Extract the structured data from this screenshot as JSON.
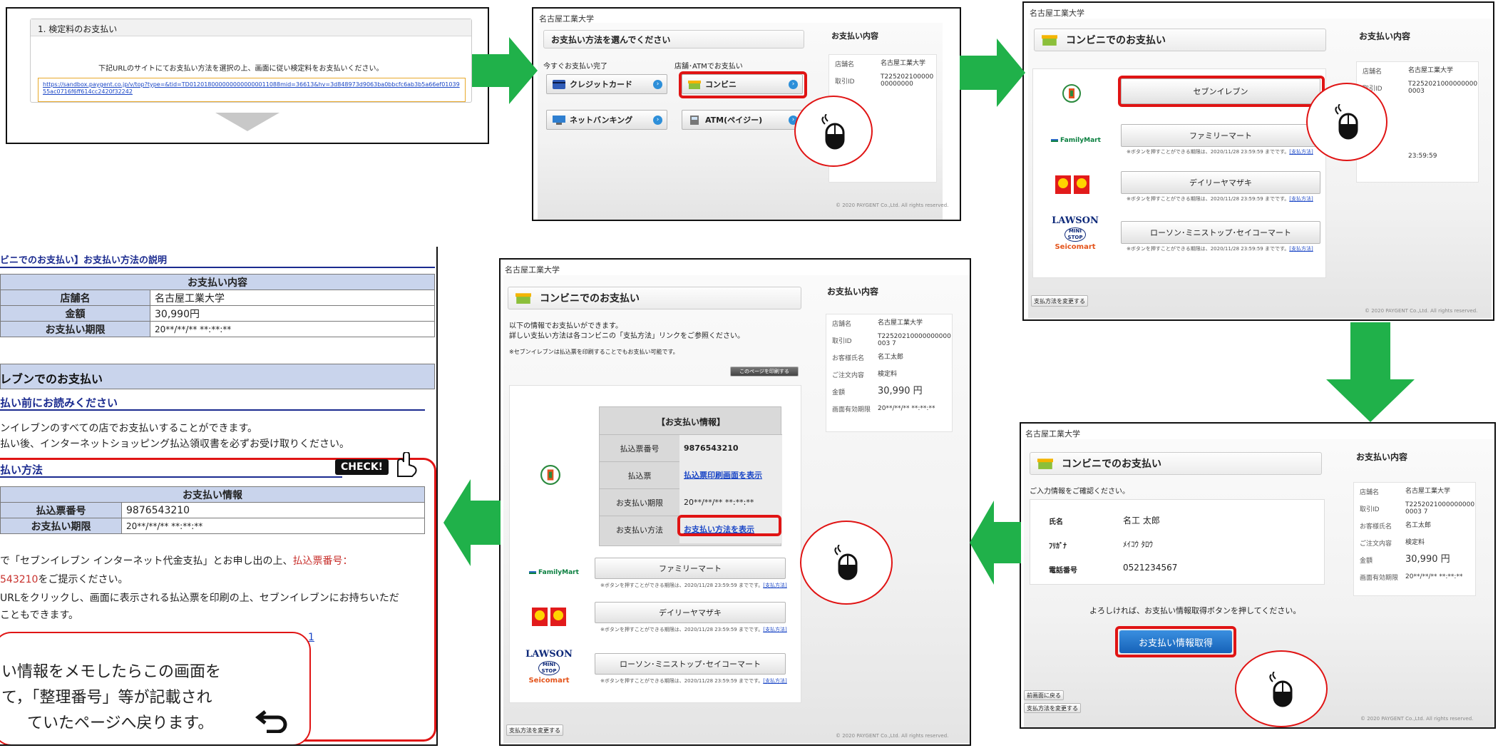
{
  "panel1": {
    "title": "1. 検定料のお支払い",
    "instruction": "下記URLのサイトにてお支払い方法を選択の上、画面に従い検定料をお支払いください。",
    "url": "https://sandbox.paygent.co.jp/v/top?type=&tid=TD0120180000000000000011088mid=36613&hv=3d848973d9063ba0bbcfc6ab3b5a66ef0103955ac0716f6ff614cc2420f32242"
  },
  "panel2": {
    "university": "名古屋工業大学",
    "heading": "お支払い方法を選んでください",
    "col1": "今すぐお支払い完了",
    "col2": "店舗･ATMでお支払い",
    "credit": "クレジットカード",
    "netbank": "ネットバンキング",
    "conveni": "コンビニ",
    "atm": "ATM(ペイジー)",
    "side_title": "お支払い内容",
    "side_rows": [
      {
        "k": "店舗名",
        "v": "名古屋工業大学"
      },
      {
        "k": "取引ID",
        "v": "T22520210000000000000"
      }
    ],
    "copyright": "© 2020 PAYGENT Co.,Ltd. All rights reserved."
  },
  "panel3": {
    "university": "名古屋工業大学",
    "heading": "コンビニでのお支払い",
    "stores": [
      "セブンイレブン",
      "ファミリーマート",
      "デイリーヤマザキ",
      "ローソン･ミニストップ･セイコーマート"
    ],
    "note_text": "※ボタンを押すことができる期限は、2020/11/28 23:59:59 までです。",
    "note_link": "[支払方法]",
    "change_method": "支払方法を変更する",
    "side_title": "お支払い内容",
    "side_rows": [
      {
        "k": "店舗名",
        "v": "名古屋工業大学"
      },
      {
        "k": "取引ID",
        "v": "T22520210000000000003"
      },
      {
        "k": "",
        "v": ""
      },
      {
        "k": "",
        "v": ""
      },
      {
        "k": "",
        "v": ""
      },
      {
        "k": "",
        "v": "23:59:59"
      }
    ],
    "copyright": "© 2020 PAYGENT Co.,Ltd. All rights reserved.",
    "logo_familymart": "FamilyMart",
    "logo_lawson": "LAWSON",
    "logo_ministop": "MINI STOP",
    "logo_seicomart": "Seicomart"
  },
  "panel4": {
    "university": "名古屋工業大学",
    "heading": "コンビニでのお支払い",
    "confirm": "ご入力情報をご確認ください。",
    "rows": [
      {
        "k": "氏名",
        "v": "名工 太郎"
      },
      {
        "k": "ﾌﾘｶﾞﾅ",
        "v": "ﾒｲｺｳ ﾀﾛｳ"
      },
      {
        "k": "電話番号",
        "v": "0521234567"
      }
    ],
    "prompt": "よろしければ、お支払い情報取得ボタンを押してください。",
    "button": "お支払い情報取得",
    "back": "前画面に戻る",
    "change_method": "支払方法を変更する",
    "side_title": "お支払い内容",
    "side_rows": [
      {
        "k": "店舗名",
        "v": "名古屋工業大学"
      },
      {
        "k": "取引ID",
        "v": "T22520210000000000003 7"
      },
      {
        "k": "お客様氏名",
        "v": "名工太郎"
      },
      {
        "k": "ご注文内容",
        "v": "検定料"
      },
      {
        "k": "金額",
        "v": "30,990 円"
      },
      {
        "k": "画面有効期限",
        "v": "20**/**/** **:**:**"
      }
    ],
    "copyright": "© 2020 PAYGENT Co.,Ltd. All rights reserved."
  },
  "panel5": {
    "university": "名古屋工業大学",
    "heading": "コンビニでのお支払い",
    "line1": "以下の情報でお支払いができます。",
    "line2": "詳しい支払い方法は各コンビニの「支払方法」リンクをご参照ください。",
    "line3": "※セブンイレブンは払込票を印刷することでもお支払い可能です。",
    "print_btn": "このページを印刷する",
    "info_title": "【お支払い情報】",
    "info_rows": [
      {
        "k": "払込票番号",
        "v": "9876543210"
      },
      {
        "k": "払込票",
        "v": "払込票印刷画面を表示"
      },
      {
        "k": "お支払い期限",
        "v": "20**/**/** **:**:**"
      },
      {
        "k": "お支払い方法",
        "v": "お支払い方法を表示"
      }
    ],
    "stores": [
      "ファミリーマート",
      "デイリーヤマザキ",
      "ローソン･ミニストップ･セイコーマート"
    ],
    "note_text": "※ボタンを押すことができる期限は、2020/11/28 23:59:59 までです。",
    "note_link": "[支払方法]",
    "change_method": "支払方法を変更する",
    "side_title": "お支払い内容",
    "side_rows": [
      {
        "k": "店舗名",
        "v": "名古屋工業大学"
      },
      {
        "k": "取引ID",
        "v": "T22520210000000000003 7"
      },
      {
        "k": "お客様氏名",
        "v": "名工太郎"
      },
      {
        "k": "ご注文内容",
        "v": "検定料"
      },
      {
        "k": "金額",
        "v": "30,990 円"
      },
      {
        "k": "画面有効期限",
        "v": "20**/**/** **:**:**"
      }
    ],
    "copyright": "© 2020 PAYGENT Co.,Ltd. All rights reserved.",
    "logo_familymart": "FamilyMart",
    "logo_lawson": "LAWSON",
    "logo_ministop": "MINI STOP",
    "logo_seicomart": "Seicomart"
  },
  "panel6": {
    "title": "ビニでのお支払い】お支払い方法の説明",
    "table_head": "お支払い内容",
    "rows": [
      {
        "k": "店舗名",
        "v": "名古屋工業大学"
      },
      {
        "k": "金額",
        "v": "30,990円"
      },
      {
        "k": "お支払い期限",
        "v": "20**/**/** **:**:**"
      }
    ],
    "section": "レブンでのお支払い",
    "sub1": "払い前にお読みください",
    "text1": "ンイレブンのすべての店でお支払いすることができます。",
    "text2": "払い後、インターネットショッピング払込領収書を必ずお受け取りください。",
    "sub2": "払い方法",
    "check": "CHECK!",
    "info_head": "お支払い情報",
    "info_rows": [
      {
        "k": "払込票番号",
        "v": "9876543210"
      },
      {
        "k": "お支払い期限",
        "v": "20**/**/** **:**:**"
      }
    ],
    "p1a": "で「セブンイレブン インターネット代金支払」とお申し出の上、",
    "p1b": "払込票番号：",
    "p1c": "543210",
    "p1d": "をご提示ください。",
    "p2": "URLをクリックし、画面に表示される払込票を印刷の上、セブンイレブンにお持ちいただ",
    "p3": "こともできます。",
    "link_fragment": "1",
    "memo1": "い情報をメモしたらこの画面を",
    "memo2": "て，「整理番号」等が記載され",
    "memo3": "ていたページへ戻ります。"
  }
}
